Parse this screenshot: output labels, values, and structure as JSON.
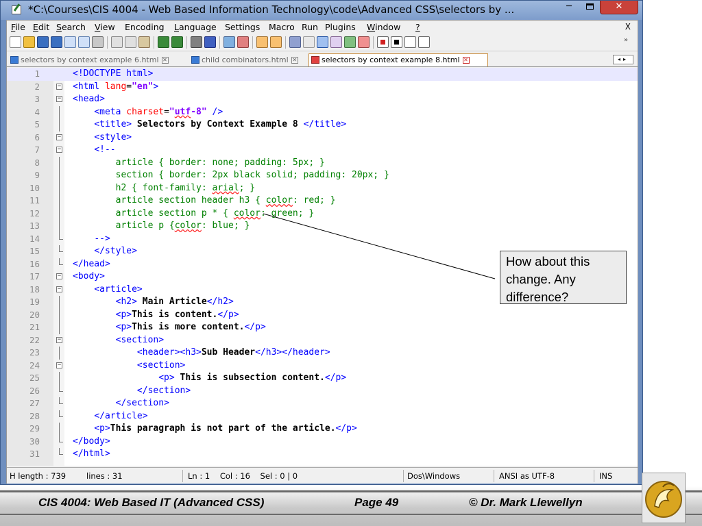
{
  "window": {
    "title": "*C:\\Courses\\CIS 4004 - Web Based Information Technology\\code\\Advanced CSS\\selectors by ...",
    "close_glyph": "✕",
    "minimize_glyph": "─"
  },
  "menu": {
    "items": [
      {
        "label": "File",
        "key": "F",
        "rest": "ile"
      },
      {
        "label": "Edit",
        "key": "E",
        "rest": "dit"
      },
      {
        "label": "Search",
        "key": "S",
        "rest": "earch"
      },
      {
        "label": "View",
        "key": "V",
        "rest": "iew"
      },
      {
        "label": "Encoding",
        "key": "",
        "rest": "Encoding"
      },
      {
        "label": "Language",
        "key": "L",
        "rest": "anguage"
      },
      {
        "label": "Settings",
        "key": "",
        "rest": "Settings"
      },
      {
        "label": "Macro",
        "key": "",
        "rest": "Macro"
      },
      {
        "label": "Run",
        "key": "",
        "rest": "Run"
      },
      {
        "label": "Plugins",
        "key": "",
        "rest": "Plugins"
      },
      {
        "label": "Window",
        "key": "W",
        "rest": "indow"
      },
      {
        "label": "?",
        "key": "?",
        "rest": ""
      }
    ],
    "close": "X"
  },
  "tabs": [
    {
      "label": "selectors by context example 6.html",
      "close": "✕",
      "active": false
    },
    {
      "label": "child combinators.html",
      "close": "✕",
      "active": false
    },
    {
      "label": "selectors by context example 8.html",
      "close": "✕",
      "active": true
    }
  ],
  "tab_scroll": "◂▸",
  "code_lines": [
    {
      "n": "1",
      "html": "<span class=\"tg\">&lt;!DOCTYPE html&gt;</span>"
    },
    {
      "n": "2",
      "html": "<span class=\"tg\">&lt;html</span> <span class=\"at\">lang</span>=<span class=\"st\">\"en\"</span><span class=\"tg\">&gt;</span>"
    },
    {
      "n": "3",
      "html": "<span class=\"tg\">&lt;head&gt;</span>"
    },
    {
      "n": "4",
      "html": "    <span class=\"tg\">&lt;meta</span> <span class=\"at\">charset</span>=<span class=\"st\">\"<span class=\"spell\">utf</span>-8\"</span> <span class=\"tg\">/&gt;</span>"
    },
    {
      "n": "5",
      "html": "    <span class=\"tg\">&lt;title&gt;</span><span class=\"tx\"> Selectors by Context Example 8 </span><span class=\"tg\">&lt;/title&gt;</span>"
    },
    {
      "n": "6",
      "html": "    <span class=\"tg\">&lt;style&gt;</span>"
    },
    {
      "n": "7",
      "html": "    <span class=\"tg\">&lt;!--</span>"
    },
    {
      "n": "8",
      "html": "        <span class=\"cm\">article { border: none; padding: 5px; }</span>"
    },
    {
      "n": "9",
      "html": "        <span class=\"cm\">section { border: 2px black solid; padding: 20px; }</span>"
    },
    {
      "n": "10",
      "html": "        <span class=\"cm\">h2 { font-family: <span class=\"spell\">arial</span>; }</span>"
    },
    {
      "n": "11",
      "html": "        <span class=\"cm\">article section header h3 { <span class=\"spell\">color</span>: red; }</span>"
    },
    {
      "n": "12",
      "html": "        <span class=\"cm\">article section p * { <span class=\"spell\">color</span>: green; }</span>"
    },
    {
      "n": "13",
      "html": "        <span class=\"cm\">article p {<span class=\"spell\">color</span>: blue; }</span>"
    },
    {
      "n": "14",
      "html": "    <span class=\"tg\">--&gt;</span>"
    },
    {
      "n": "15",
      "html": "    <span class=\"tg\">&lt;/style&gt;</span>"
    },
    {
      "n": "16",
      "html": "<span class=\"tg\">&lt;/head&gt;</span>"
    },
    {
      "n": "17",
      "html": "<span class=\"tg\">&lt;body&gt;</span>"
    },
    {
      "n": "18",
      "html": "    <span class=\"tg\">&lt;article&gt;</span>"
    },
    {
      "n": "19",
      "html": "        <span class=\"tg\">&lt;h2&gt;</span><span class=\"tx\"> Main Article</span><span class=\"tg\">&lt;/h2&gt;</span>"
    },
    {
      "n": "20",
      "html": "        <span class=\"tg\">&lt;p&gt;</span><span class=\"tx\">This is content.</span><span class=\"tg\">&lt;/p&gt;</span>"
    },
    {
      "n": "21",
      "html": "        <span class=\"tg\">&lt;p&gt;</span><span class=\"tx\">This is more content.</span><span class=\"tg\">&lt;/p&gt;</span>"
    },
    {
      "n": "22",
      "html": "        <span class=\"tg\">&lt;section&gt;</span>"
    },
    {
      "n": "23",
      "html": "            <span class=\"tg\">&lt;header&gt;&lt;h3&gt;</span><span class=\"tx\">Sub Header</span><span class=\"tg\">&lt;/h3&gt;&lt;/header&gt;</span>"
    },
    {
      "n": "24",
      "html": "            <span class=\"tg\">&lt;section&gt;</span>"
    },
    {
      "n": "25",
      "html": "                <span class=\"tg\">&lt;p&gt;</span><span class=\"tx\"> This is subsection content.</span><span class=\"tg\">&lt;/p&gt;</span>"
    },
    {
      "n": "26",
      "html": "            <span class=\"tg\">&lt;/section&gt;</span>"
    },
    {
      "n": "27",
      "html": "        <span class=\"tg\">&lt;/section&gt;</span>"
    },
    {
      "n": "28",
      "html": "    <span class=\"tg\">&lt;/article&gt;</span>"
    },
    {
      "n": "29",
      "html": "    <span class=\"tg\">&lt;p&gt;</span><span class=\"tx\">This paragraph is not part of the article.</span><span class=\"tg\">&lt;/p&gt;</span>"
    },
    {
      "n": "30",
      "html": "<span class=\"tg\">&lt;/body&gt;</span>"
    },
    {
      "n": "31",
      "html": "<span class=\"tg\">&lt;/html&gt;</span>"
    }
  ],
  "status": {
    "length": "H length : 739",
    "lines": "lines : 31",
    "pos": "Ln : 1    Col : 16    Sel : 0 | 0",
    "eol": "Dos\\Windows",
    "encoding": "ANSI as UTF-8",
    "mode": "INS"
  },
  "callout": {
    "line1": "How about this",
    "line2": "change.  Any",
    "line3": "difference?"
  },
  "footer": {
    "course": "CIS 4004: Web Based IT (Advanced CSS)",
    "page": "Page 49",
    "author": "© Dr. Mark Llewellyn"
  },
  "icons": {
    "app": "notepad-plus-icon",
    "logo": "ucf-pegasus-logo"
  },
  "colors": {
    "tag": "#0000ff",
    "attribute": "#ff0000",
    "string": "#8000ff",
    "comment": "#008000",
    "window_frame": "#6f8fbf",
    "close_button": "#c9423a"
  }
}
